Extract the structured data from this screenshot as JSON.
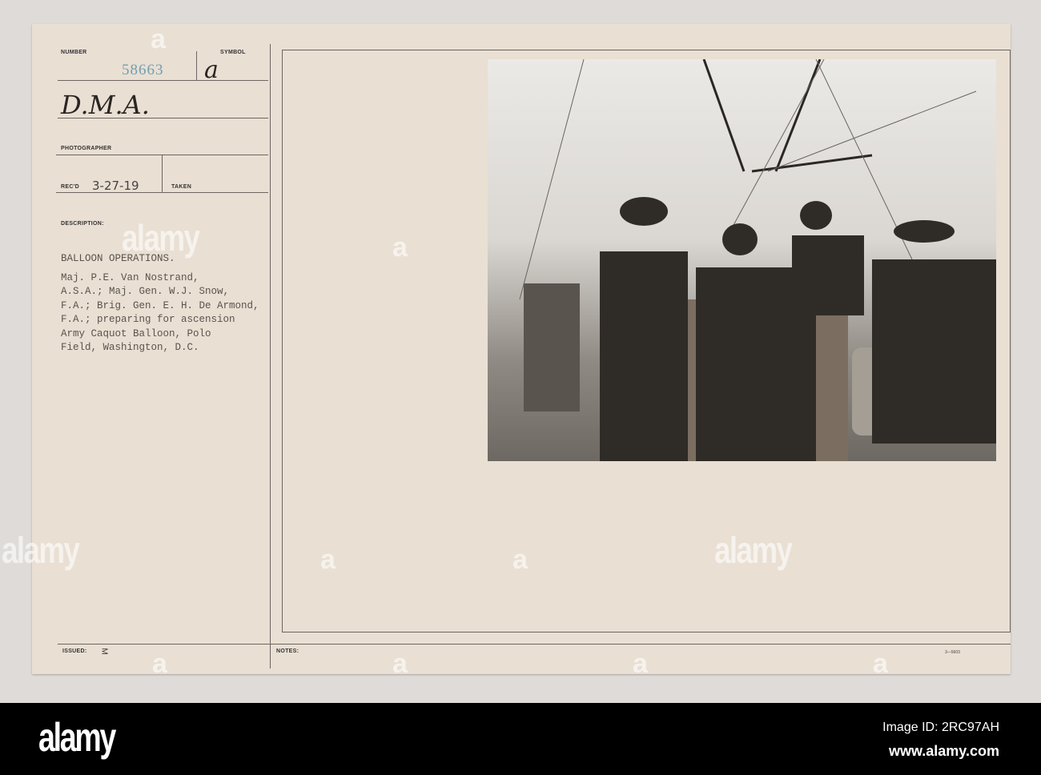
{
  "card": {
    "number_label": "NUMBER",
    "number": "58663",
    "symbol_label": "SYMBOL",
    "symbol": "a",
    "unit": "D.M.A.",
    "photographer_label": "PHOTOGRAPHER",
    "recd_label": "REC'D",
    "recd_date": "3-27-19",
    "taken_label": "TAKEN",
    "description_label": "DESCRIPTION:",
    "title": "BALLOON OPERATIONS.",
    "description": "Maj. P.E. Van Nostrand,\nA.S.A.; Maj. Gen. W.J. Snow,\nF.A.; Brig. Gen. E. H. De Armond,\nF.A.; preparing for ascension\nArmy Caquot Balloon, Polo\nField, Washington, D.C.",
    "issued_label": "ISSUED:",
    "issued_mark": "M",
    "notes_label": "NOTES:",
    "form_number": "3—5603"
  },
  "watermark": {
    "text": "alamy",
    "letter": "a"
  },
  "footer": {
    "logo": "alamy",
    "image_id": "Image ID: 2RC97AH",
    "url": "www.alamy.com"
  }
}
